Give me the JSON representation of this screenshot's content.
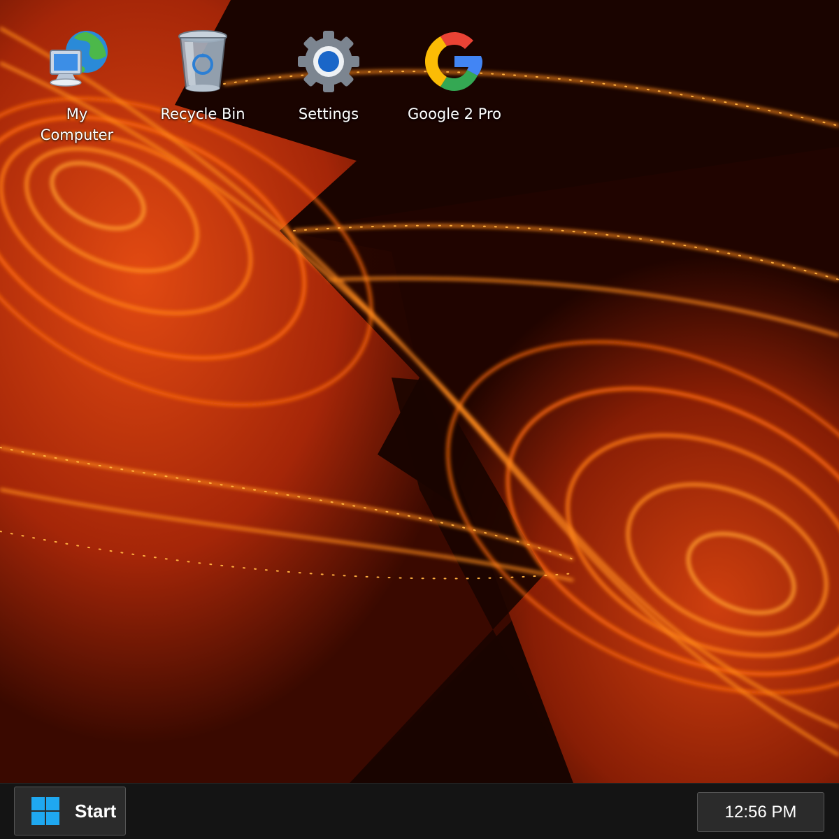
{
  "desktop": {
    "icons": [
      {
        "label": "My Computer",
        "icon": "my-computer-icon"
      },
      {
        "label": "Recycle Bin",
        "icon": "recycle-bin-icon"
      },
      {
        "label": "Settings",
        "icon": "gear-icon"
      },
      {
        "label": "Google 2 Pro",
        "icon": "google-icon"
      }
    ]
  },
  "taskbar": {
    "start_label": "Start",
    "clock": "12:56 PM"
  },
  "colors": {
    "wallpaper_base": "#c2320a",
    "wallpaper_glow": "#ff8a1a",
    "taskbar_bg": "#141414",
    "windows_logo": "#1fa8f0"
  }
}
